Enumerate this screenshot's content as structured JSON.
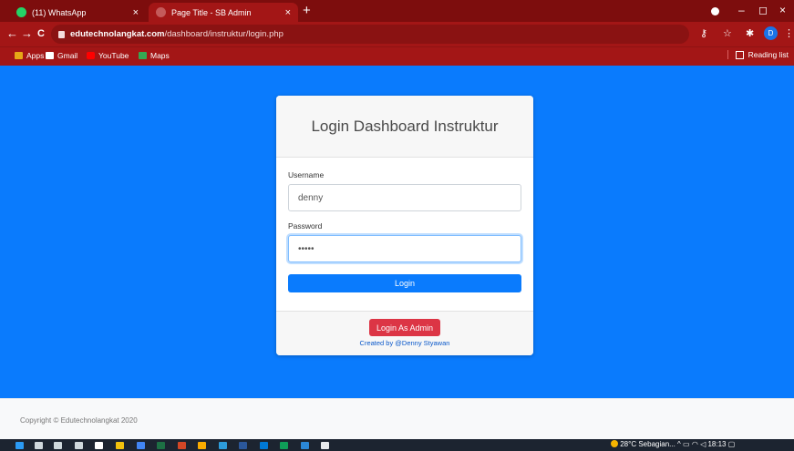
{
  "browser": {
    "tabs": [
      {
        "title": "(11) WhatsApp",
        "close": "×"
      },
      {
        "title": "Page Title - SB Admin",
        "close": "×"
      }
    ],
    "new_tab": "+",
    "window_controls": {
      "minimize": "–",
      "maximize": "◻",
      "close": "×"
    },
    "nav": {
      "back": "←",
      "forward": "→",
      "reload": "C"
    },
    "url_host": "edutechnolangkat.com",
    "url_path": "/dashboard/instruktur/login.php",
    "profile_initial": "D",
    "bookmarks": [
      "Apps",
      "Gmail",
      "YouTube",
      "Maps"
    ],
    "reading_list": "Reading list",
    "colors": {
      "tabbar": "#7d0d0d",
      "toolbar": "#a31616"
    }
  },
  "login": {
    "heading": "Login Dashboard Instruktur",
    "username_label": "Username",
    "username_value": "denny",
    "password_label": "Password",
    "password_value": "•••••",
    "login_button": "Login",
    "admin_button": "Login As Admin",
    "credit": "Created by @Denny Styawan"
  },
  "footer": {
    "copyright": "Copyright © Edutechnolangkat 2020"
  },
  "taskbar": {
    "weather": "28°C Sebagian...",
    "time": "18:13",
    "tray_icons": [
      "chevron-up-icon",
      "battery-icon",
      "wifi-icon",
      "volume-icon"
    ]
  },
  "theme": {
    "page_bg": "#0a7bfd",
    "primary": "#0a7bfd",
    "danger": "#dc3545"
  }
}
